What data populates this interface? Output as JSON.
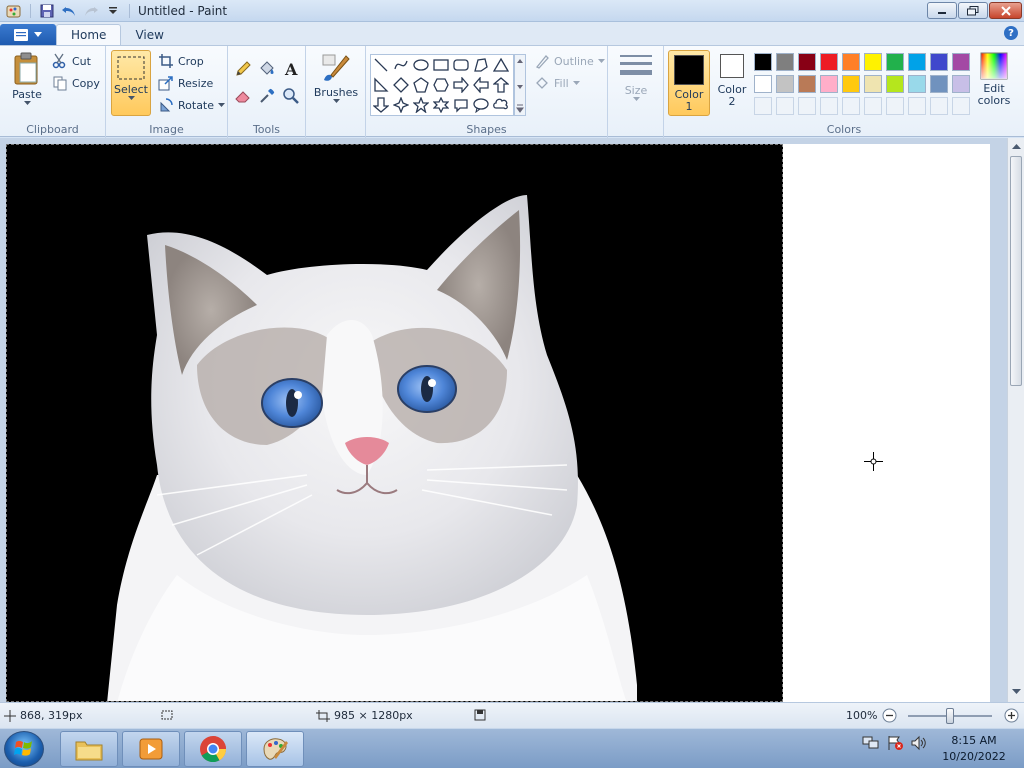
{
  "window": {
    "title": "Untitled - Paint"
  },
  "tabs": [
    {
      "label": "Home"
    },
    {
      "label": "View"
    }
  ],
  "ribbon": {
    "clipboard": {
      "group_label": "Clipboard",
      "paste": "Paste",
      "cut": "Cut",
      "copy": "Copy"
    },
    "image": {
      "group_label": "Image",
      "select": "Select",
      "crop": "Crop",
      "resize": "Resize",
      "rotate": "Rotate"
    },
    "tools": {
      "group_label": "Tools"
    },
    "brushes": {
      "label": "Brushes"
    },
    "shapes": {
      "group_label": "Shapes",
      "outline": "Outline",
      "fill": "Fill"
    },
    "size": {
      "label": "Size"
    },
    "colors": {
      "group_label": "Colors",
      "color1": "Color",
      "color1_num": "1",
      "color2": "Color",
      "color2_num": "2",
      "edit_colors_1": "Edit",
      "edit_colors_2": "colors",
      "color1_value": "#000000",
      "color2_value": "#ffffff",
      "palette_row1": [
        "#000000",
        "#7f7f7f",
        "#880015",
        "#ed1c24",
        "#ff7f27",
        "#fff200",
        "#22b14c",
        "#00a2e8",
        "#3f48cc",
        "#a349a4"
      ],
      "palette_row2": [
        "#ffffff",
        "#c3c3c3",
        "#b97a57",
        "#ffaec9",
        "#ffc90e",
        "#efe4b0",
        "#b5e61d",
        "#99d9ea",
        "#7092be",
        "#c8bfe7"
      ]
    }
  },
  "status": {
    "cursor_pos": "868, 319px",
    "image_size": "985 × 1280px",
    "zoom": "100%"
  },
  "taskbar": {
    "time": "8:15 AM",
    "date": "10/20/2022"
  }
}
